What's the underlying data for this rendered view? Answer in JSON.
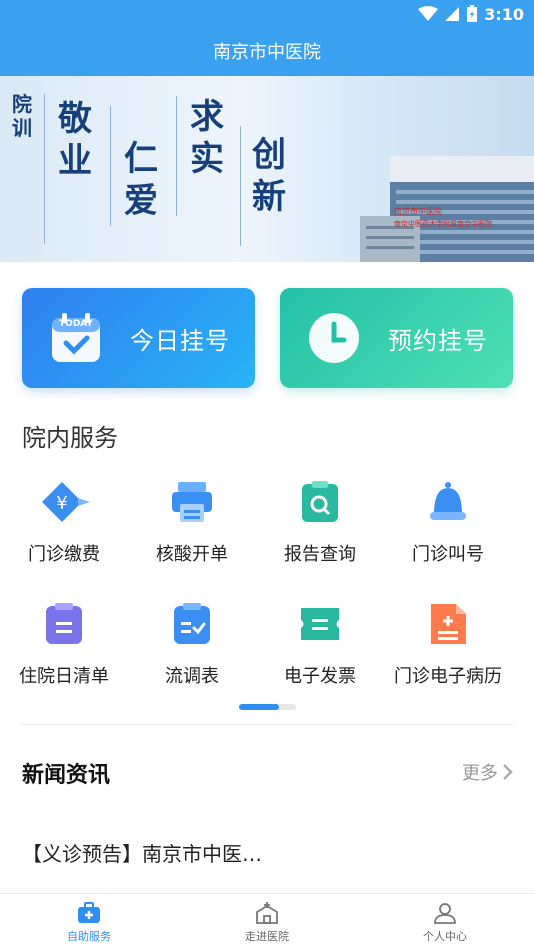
{
  "status_bar": {
    "time": "3:10"
  },
  "app": {
    "title": "南京市中医院"
  },
  "banner": {
    "motto_label": "院训",
    "motto_words": [
      "敬业",
      "仁爱",
      "求实",
      "创新"
    ],
    "building_sign_1": "南京市中医院",
    "building_sign_2": "南京中医药大学附属南京中医院"
  },
  "quick_actions": {
    "today": {
      "label": "今日挂号",
      "icon_text": "TODAY",
      "icon": "calendar-today-icon"
    },
    "appointment": {
      "label": "预约挂号",
      "icon": "clock-icon"
    }
  },
  "services": {
    "title": "院内服务",
    "items": [
      {
        "label": "门诊缴费",
        "icon": "yuan-payment-icon"
      },
      {
        "label": "核酸开单",
        "icon": "printer-icon"
      },
      {
        "label": "报告查询",
        "icon": "report-search-icon"
      },
      {
        "label": "门诊叫号",
        "icon": "bell-icon"
      },
      {
        "label": "住院日清单",
        "icon": "clipboard-icon"
      },
      {
        "label": "流调表",
        "icon": "checklist-icon"
      },
      {
        "label": "电子发票",
        "icon": "ticket-icon"
      },
      {
        "label": "门诊电子病历",
        "icon": "medical-record-icon"
      }
    ]
  },
  "news": {
    "title": "新闻资讯",
    "more_label": "更多",
    "items": [
      {
        "title": "【义诊预告】南京市中医…"
      }
    ]
  },
  "tabbar": {
    "items": [
      {
        "label": "自助服务",
        "active": true
      },
      {
        "label": "走进医院",
        "active": false
      },
      {
        "label": "个人中心",
        "active": false
      }
    ]
  },
  "colors": {
    "primary": "#2f8ff0",
    "header": "#3aa0f0",
    "teal": "#23c0a8"
  }
}
